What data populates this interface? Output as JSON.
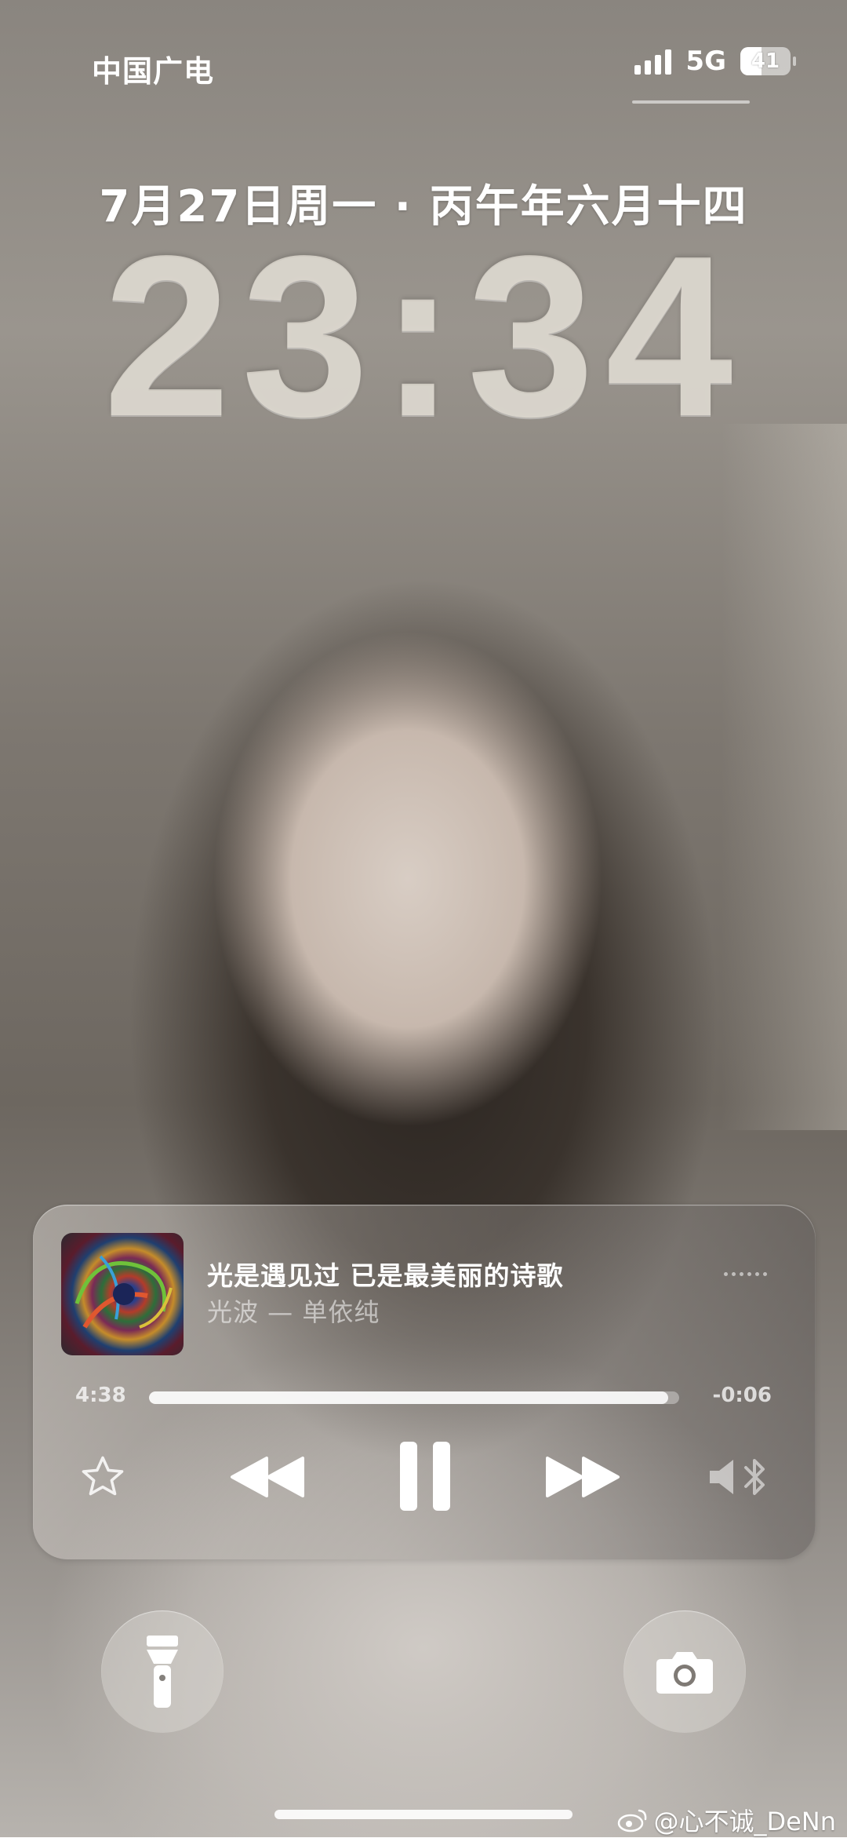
{
  "status_bar": {
    "carrier": "中国广电",
    "network": "5G",
    "battery": "41",
    "battery_level": 0.41,
    "signal_bars": 4
  },
  "lock": {
    "date": "7月27日周一 · 丙午年六月十四",
    "time": "23:34"
  },
  "now_playing": {
    "title": "光是遇见过 已是最美丽的诗歌",
    "subtitle": "光波 — 单依纯",
    "elapsed": "4:38",
    "remaining": "-0:06",
    "progress": 0.98,
    "icons": {
      "favorite": "star-icon",
      "previous": "rewind-icon",
      "play_state": "pause-icon",
      "next": "fast-forward-icon",
      "output": "speaker-bluetooth-icon",
      "route": "more-dots-icon"
    }
  },
  "shortcuts": {
    "left": "flashlight-icon",
    "right": "camera-icon"
  },
  "watermark": "@心不诚_DeNn"
}
